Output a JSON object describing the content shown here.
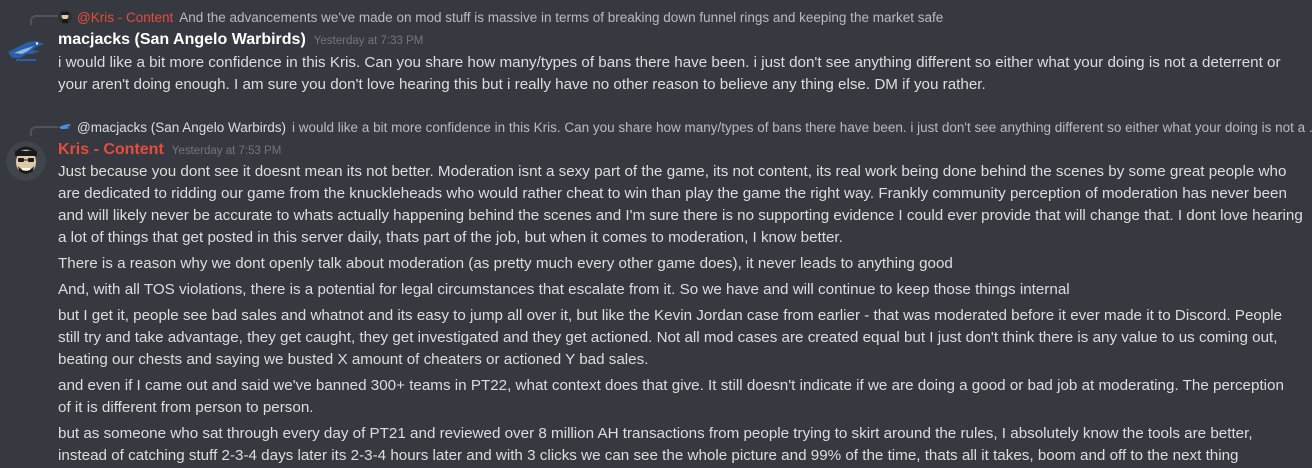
{
  "messages": [
    {
      "reply": {
        "author": "@Kris - Content",
        "author_color": "#e74c3c",
        "text": "And the advancements we've made on mod stuff is massive in terms of breaking down funnel rings and keeping the market safe"
      },
      "author": "macjacks (San Angelo Warbirds)",
      "author_color": "#ffffff",
      "timestamp": "Yesterday at 7:33 PM",
      "paragraphs": [
        {
          "lines": [
            "i would like a bit more confidence in this Kris. Can you share how many/types of bans there have been.  i just don't see anything different so either what your doing is not a deterrent or",
            "your aren't doing enough.  I am sure you don't love hearing this but i really have no other reason to believe any thing else.  DM if you rather."
          ]
        }
      ]
    },
    {
      "reply": {
        "author": "@macjacks (San Angelo Warbirds)",
        "author_color": "#dcddde",
        "text": "i would like a bit more confidence in this Kris. Can you share how many/types of bans there have been.  i just don't see anything different so either what your doing is not a ..."
      },
      "author": "Kris - Content",
      "author_color": "#e74c3c",
      "timestamp": "Yesterday at 7:53 PM",
      "paragraphs": [
        {
          "lines": [
            "Just because you dont see it doesnt mean its not better.  Moderation isnt a sexy part of the game, its not content, its real work being done behind the scenes by some great people who",
            "are dedicated to ridding our game from the knuckleheads who would rather cheat to win than play the game the right way.  Frankly community perception of moderation has never been",
            "and will likely never be accurate to whats actually happening behind the scenes and I'm sure there is no supporting evidence I could ever provide that will change that.  I dont love hearing",
            "a lot of things that get posted in this server daily, thats part of the job, but when it comes to moderation, I know better."
          ]
        },
        {
          "lines": [
            "There is a reason why we dont openly talk about moderation (as pretty much every other game does), it never leads to anything good"
          ]
        },
        {
          "lines": [
            "And, with all TOS violations, there is a potential for legal circumstances that escalate from it.  So we have and will continue to keep those things internal"
          ]
        },
        {
          "lines": [
            "but I get it, people see bad sales and whatnot and its easy to jump all over it, but like the Kevin Jordan case from earlier - that was moderated before it ever made it to Discord.  People",
            "still try and take advantage, they get caught, they get investigated and they get actioned.  Not all mod cases are created equal but I just don't think there is any value to us coming out,",
            "beating our chests and saying we busted X amount of cheaters or actioned Y bad sales."
          ]
        },
        {
          "lines": [
            "and even if I came out and said we've banned 300+ teams in PT22, what context does that give.  It still doesn't indicate if we are doing a good or bad job at moderating.  The perception",
            "of it is different from person to person."
          ]
        },
        {
          "lines": [
            "but as someone who sat through every day of PT21 and reviewed over 8 million AH transactions from people trying to skirt around the rules, I absolutely know the tools are better,",
            "instead of catching stuff 2-3-4 days later its 2-3-4 hours later and with 3 clicks we can see the whole picture and 99% of the time, thats all it takes, boom and off to the next thing"
          ]
        }
      ]
    }
  ]
}
